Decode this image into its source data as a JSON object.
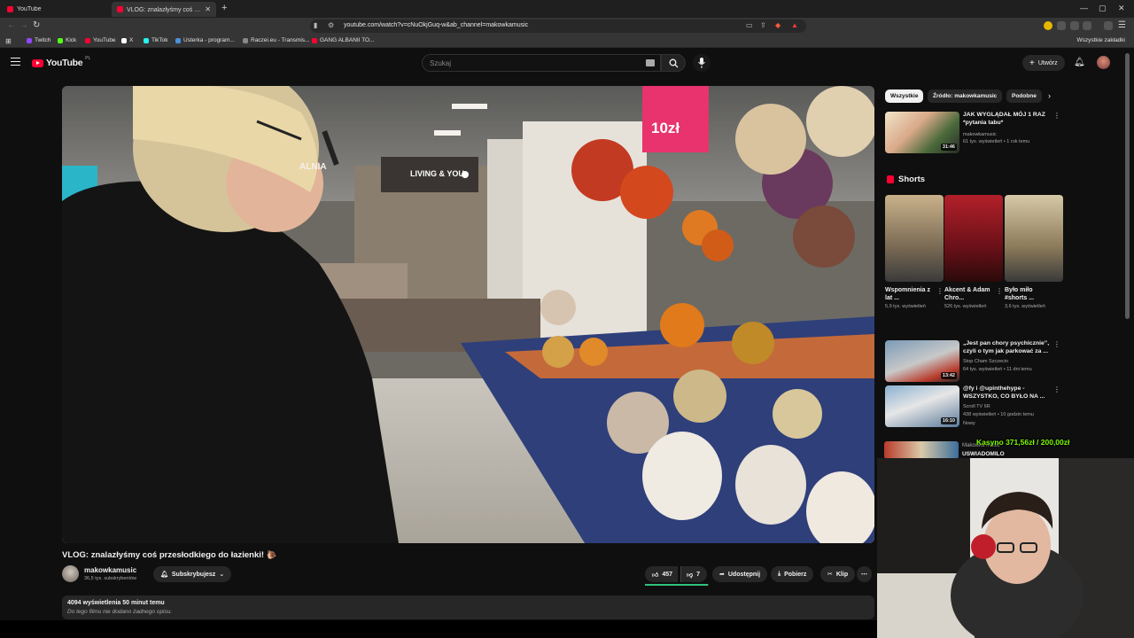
{
  "browser": {
    "tabs": [
      {
        "title": "YouTube"
      },
      {
        "title": "VLOG: znalazłyśmy coś przesłodkiego do łazienki! 🐪 - YouTube"
      }
    ],
    "url": "youtube.com/watch?v=cNuOkjGuq-w&ab_channel=makowkamusic",
    "bookmarks": [
      {
        "label": "Twitch",
        "color": "#9146ff"
      },
      {
        "label": "Kick",
        "color": "#53fc18"
      },
      {
        "label": "YouTube",
        "color": "#ff0033"
      },
      {
        "label": "X",
        "color": "#ffffff"
      },
      {
        "label": "TikTok",
        "color": "#25f4ee"
      },
      {
        "label": "Usterka - program...",
        "color": "#4a90d9"
      },
      {
        "label": "Raczei.eu - Transmis...",
        "color": "#888888"
      },
      {
        "label": "GANG ALBANII TO...",
        "color": "#ff0033"
      }
    ],
    "all_bookmarks": "Wszystkie zakładki"
  },
  "masthead": {
    "logo": "YouTube",
    "logo_region": "PL",
    "search_placeholder": "Szukaj",
    "create_label": "Utwórz"
  },
  "video": {
    "title": "VLOG: znalazłyśmy coś przesłodkiego do łazienki! 🐌",
    "channel": "makowkamusic",
    "subscribers": "36,5 tys. subskrybentów",
    "subscribed_label": "Subskrybujesz",
    "likes": "457",
    "dislikes": "7",
    "like_ratio": 0.98,
    "share_label": "Udostępnij",
    "download_label": "Pobierz",
    "clip_label": "Klip",
    "views_time": "4094 wyświetlenia  50 minut temu",
    "description": "Do tego filmu nie dodano żadnego opisu.",
    "scene_text": {
      "store_sign": "LIVING & YOU",
      "price_tag": "10zł",
      "side_sign": "ALNIA"
    }
  },
  "sidebar": {
    "chips": [
      "Wszystkie",
      "Źródło: makowkamusic",
      "Podobne"
    ],
    "recommendations_top": [
      {
        "title": "JAK WYGLĄDAŁ MÓJ 1 RAZ *pytania tabu*",
        "channel": "makowkamusic",
        "meta": "61 tys. wyświetleń • 1 rok temu",
        "duration": "31:46"
      }
    ],
    "shorts_title": "Shorts",
    "shorts": [
      {
        "title": "Wspomnienia z lat ...",
        "views": "5,9 tys. wyświetleń"
      },
      {
        "title": "Akcent & Adam Chro...",
        "views": "526 tys. wyświetleń"
      },
      {
        "title": "Było miło #shorts ...",
        "views": "3,6 tys. wyświetleń"
      }
    ],
    "recommendations": [
      {
        "title": "„Jest pan chory psychicznie”, czyli o tym jak parkować za ...",
        "channel": "Stop Cham Szczecin",
        "meta": "64 tys. wyświetleń • 11 dni temu",
        "duration": "13:42"
      },
      {
        "title": "@fy i @upinthehype - WSZYSTKO, CO BYŁO NA ...",
        "channel": "Scroll TV 6R",
        "meta": "438 wyświetleń • 10 godzin temu",
        "extra": "Nowy",
        "duration": "16:10"
      }
    ],
    "partial": {
      "channel": "Makowka music ",
      "title": "USWIADOMILO"
    }
  },
  "overlay": {
    "donation_goal": "Kasyno 371,56zł / 200,00zł"
  },
  "colors": {
    "bg": "#0f0f0f",
    "accent_red": "#ff0033",
    "like_green": "#2ec27e",
    "goal_green": "#7CFC00"
  }
}
